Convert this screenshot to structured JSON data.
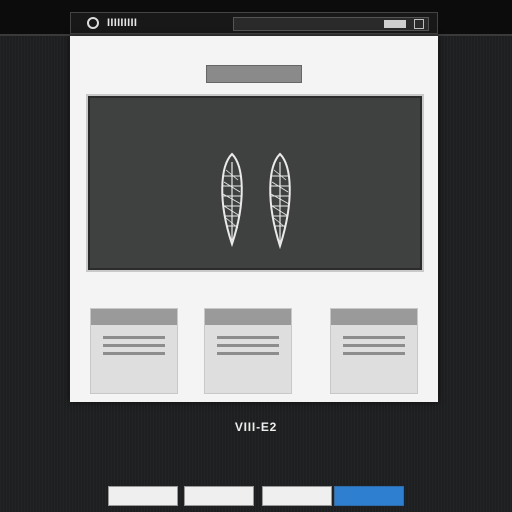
{
  "topbar": {
    "logo_text": "IIIIIIIII"
  },
  "header": {
    "title": "",
    "subtitle": ""
  },
  "hero": {
    "caption": ""
  },
  "cards": [
    {
      "header": "",
      "title": "",
      "lines": 3
    },
    {
      "header": "",
      "title": "",
      "lines": 3
    },
    {
      "header": "",
      "title": "",
      "lines": 3
    }
  ],
  "footer": {
    "title": "VIII-E2",
    "lines": [
      "",
      ""
    ],
    "buttons": [
      {
        "label": "",
        "style": "white"
      },
      {
        "label": "",
        "style": "white"
      },
      {
        "label": "",
        "style": "white"
      },
      {
        "label": "",
        "style": "blue"
      }
    ]
  },
  "colors": {
    "background": "#1e1f20",
    "panel": "#f4f4f4",
    "hero_bg": "#3f4040",
    "card_header": "#9a9a9a",
    "accent_blue": "#2f7fd1"
  }
}
